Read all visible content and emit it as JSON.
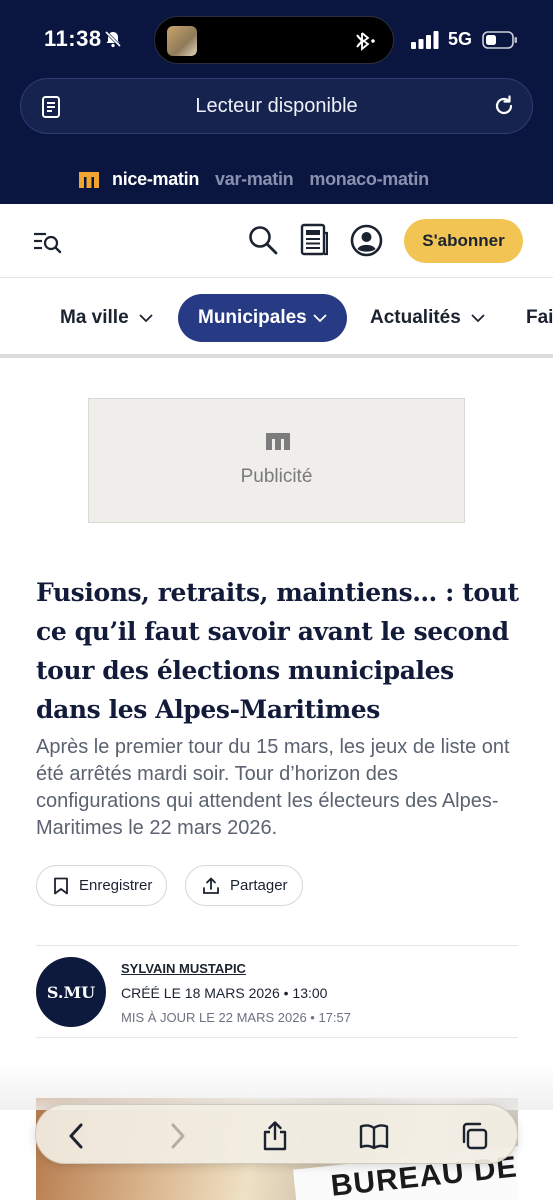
{
  "status_bar": {
    "time": "11:38",
    "network": "5G"
  },
  "url_bar": {
    "text": "Lecteur disponible"
  },
  "brand_bar": {
    "brands": [
      {
        "label": "nice-matin",
        "active": true
      },
      {
        "label": "var-matin",
        "active": false
      },
      {
        "label": "monaco-matin",
        "active": false
      }
    ]
  },
  "header": {
    "subscribe_label": "S'abonner"
  },
  "nav": {
    "items": [
      {
        "label": "Ma ville",
        "active": false
      },
      {
        "label": "Municipales",
        "active": true
      },
      {
        "label": "Actualités",
        "active": false
      },
      {
        "label": "Fai",
        "active": false
      }
    ]
  },
  "ad": {
    "label": "Publicité"
  },
  "article": {
    "headline": "Fusions, retraits, maintiens… : tout ce qu’il faut savoir avant le second tour des élections municipales dans les Alpes-Maritimes",
    "lede": "Après le premier tour du 15 mars, les jeux de liste ont été arrêtés mardi soir. Tour d’horizon des configurations qui attendent les électeurs des Alpes-Maritimes le 22 mars 2026.",
    "save_label": "Enregistrer",
    "share_label": "Partager"
  },
  "byline": {
    "initials": "S.MU",
    "author": "SYLVAIN MUSTAPIC",
    "created": "CRÉÉ LE 18 MARS 2026 • 13:00",
    "updated": "MIS À JOUR LE 22 MARS 2026 • 17:57"
  },
  "photo": {
    "sign_text": "BUREAU DE VOTE"
  },
  "colors": {
    "top_bar": "#0b1640",
    "accent_nav": "#273b85",
    "subscribe": "#f1c454",
    "brand_logo": "#f1a531",
    "headline": "#131b3a"
  },
  "toolbar": {
    "icons": [
      "back-icon",
      "forward-icon",
      "share-icon",
      "bookmarks-icon",
      "tabs-icon"
    ]
  }
}
